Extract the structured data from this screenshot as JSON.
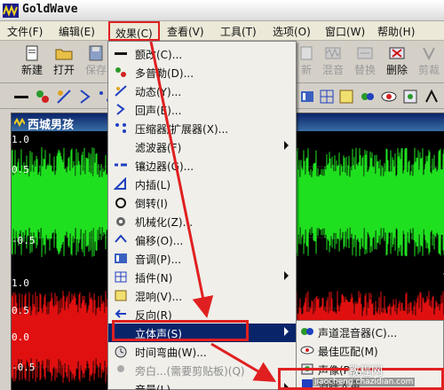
{
  "app": {
    "title": "GoldWave"
  },
  "menubar": [
    {
      "label": "文件(F)"
    },
    {
      "label": "编辑(E)"
    },
    {
      "label": "效果(C)",
      "highlighted": true
    },
    {
      "label": "查看(V)"
    },
    {
      "label": "工具(T)"
    },
    {
      "label": "选项(O)"
    },
    {
      "label": "窗口(W)"
    },
    {
      "label": "帮助(H)"
    }
  ],
  "toolbar": {
    "new_label": "新建",
    "open_label": "打开",
    "save_label": "保存",
    "new2_label": "新",
    "mix_label": "混音",
    "replace_label": "替换",
    "delete_label": "删除",
    "trim_label": "剪裁"
  },
  "wave_window": {
    "title": "西城男孩",
    "scale_top": [
      "1.0",
      "0.5",
      "-0.5"
    ],
    "scale_bottom": [
      "1.0",
      "0.5",
      "0.0",
      "-0.5"
    ],
    "colors": {
      "top_channel": "#1fe01f",
      "bottom_channel": "#e01010"
    }
  },
  "effects_menu": {
    "items": [
      {
        "label": "颤改(C)...",
        "icon": "vibrato-icon"
      },
      {
        "label": "多普勒(D)...",
        "icon": "doppler-icon"
      },
      {
        "label": "动态(Y)...",
        "icon": "dynamics-icon"
      },
      {
        "label": "回声(E)...",
        "icon": "echo-icon"
      },
      {
        "label": "压缩器/扩展器(X)...",
        "icon": "compressor-icon"
      },
      {
        "label": "滤波器(F)",
        "icon": "",
        "submenu": true
      },
      {
        "label": "镶边器(G)...",
        "icon": "flanger-icon"
      },
      {
        "label": "内插(L)",
        "icon": "interpolate-icon"
      },
      {
        "label": "倒转(I)",
        "icon": "invert-icon"
      },
      {
        "label": "机械化(Z)...",
        "icon": "mechanize-icon"
      },
      {
        "label": "偏移(O)...",
        "icon": "offset-icon"
      },
      {
        "label": "音调(P)...",
        "icon": "pitch-icon"
      },
      {
        "label": "插件(N)",
        "icon": "plugin-icon",
        "submenu": true
      },
      {
        "label": "混响(V)...",
        "icon": "reverb-icon"
      },
      {
        "label": "反向(R)",
        "icon": "reverse-icon"
      },
      {
        "label": "立体声(S)",
        "icon": "",
        "submenu": true,
        "selected": true
      },
      {
        "label": "时间弯曲(W)...",
        "icon": "timewarp-icon"
      },
      {
        "label": "旁白...(需要剪贴板)(Q)",
        "icon": "voiceover-icon",
        "disabled": true
      },
      {
        "label": "音量(L)",
        "icon": "",
        "submenu": true
      }
    ]
  },
  "stereo_submenu": {
    "items": [
      {
        "label": "声道混音器(C)...",
        "icon": "channel-mixer-icon"
      },
      {
        "label": "最佳匹配(M)",
        "icon": "match-icon"
      },
      {
        "label": "声像(P)...",
        "icon": "pan-icon"
      },
      {
        "label": "消除人声",
        "icon": "vocal-remove-icon",
        "highlighted": true
      }
    ]
  },
  "watermark": {
    "text": "教程网",
    "url": "jiaocheng.chazidian.com"
  }
}
